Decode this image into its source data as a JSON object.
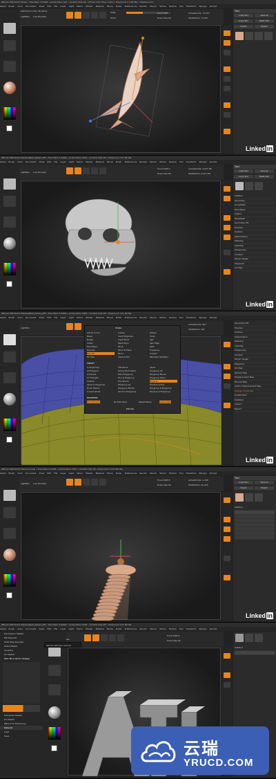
{
  "app": {
    "title_bar_1": "ZBrush 4R6 64-bit   Shark • Free Mem 3.24GB • Active Mem 700 • Scratch Disk 48 • ZTime 1.05 Timer 0.001 • PolyCount 1.4 Mil Mp • MeshCount 1",
    "title_bar_2": "ZBrush 4R6 64-bit   ZSphereBall_Sphere_Eff • Free Mem 4.15GB • Active Mem 1184 • Scratch Disk 48 • PolyCount 2.57 Mil Mp",
    "title_bar_3": "ZBrush 4R6 64-bit   ZSphereBall_Sphere_Eff • Free Mem 3.43GB • Active Mem 1366 • Scratch Disk 48 • PolyCount 1.21 Mil Mp",
    "title_bar_4": "ZBrush 4R6 64-bit   Helixed screw • Free Mem 5.12GB • Active Mem 1052 • Scratch Disk 48 • PolyCount 1.014 Mil Mp",
    "title_bar_5": "ZBrush 4R6 64-bit   ZSphereBall_Sphere_Eff • Free Mem 3.90GB • Active Mem 1336 • Scratch Disk 48 • PolyCount 2.21 Mil Mp"
  },
  "menubar": [
    "Alpha",
    "Brush",
    "Color",
    "Document",
    "Draw",
    "Edit",
    "File",
    "Layer",
    "Light",
    "Macro",
    "Marker",
    "Material",
    "Movie",
    "Picker",
    "Preferences",
    "Render",
    "Stencil",
    "Stroke",
    "Texture",
    "Tool",
    "Transform",
    "Zplugin",
    "Zscript"
  ],
  "toolbar": {
    "lightbox": "LightBox",
    "live_boolean": "Live Boolean",
    "edit": "Edit",
    "draw": "Draw",
    "move": "Move",
    "scale": "Scale",
    "rotate": "Rotate",
    "mrgb": "Mrgb",
    "rgb": "Rgb",
    "m": "M",
    "zadd": "Zadd",
    "zsub": "Zsub",
    "focal_shift": "Focal Shift 0",
    "draw_size": "Draw Size 64",
    "dynamic": "Dynamic",
    "active_points": "ActivePoints: 73,347",
    "total_points": "TotalPoints: 73,347",
    "active_points_2": "ActivePoints: 2.977 Mil",
    "total_points_2": "TotalPoints: 2.977 Mil",
    "active_points_3": "ActivePoints: 407",
    "total_points_3": "TotalPoints: 407",
    "active_points_4": "ActivePoints: 1.156",
    "total_points_4": "TotalPoints: 16,004"
  },
  "status_1": "Deformer Lines: 46 elbow",
  "left_shelf": {
    "alpha_off": "Alpha Off",
    "texture_off": "Texture Off",
    "gradient": "Gradient",
    "switch_color": "SwitchColor",
    "alternate": "Alternate"
  },
  "tray": {
    "header": "Tool",
    "buttons": [
      "Load Tool",
      "Save As",
      "Copy Tool",
      "Paste Tool",
      "Import",
      "Export",
      "Clone",
      "Make PolyMesh3D",
      "GoZ",
      "All",
      "Visible",
      "R"
    ],
    "lightbox_tools": "Lightbox▸Tools",
    "subtool_items": [
      "SubTool",
      "Geometry",
      "ArrayMesh",
      "NanoMesh",
      "Layers",
      "FiberMesh",
      "Geometry HD",
      "Preview",
      "Surface",
      "Deformation",
      "Masking",
      "Visibility",
      "Polygroups",
      "Contact",
      "Morph Target",
      "Polypaint",
      "UV Map",
      "Texture Map",
      "Displacement Map",
      "Normal Map",
      "Vector Displacement Map",
      "Display Properties",
      "Unified Skin",
      "Initialize",
      "Import",
      "Export"
    ]
  },
  "popup": {
    "title": "Stroke",
    "items_col1": [
      "Add To Curve",
      "Bevel",
      "Bridge",
      "Chisel",
      "Del Hidden",
      "Equalize",
      "Extrude",
      "Fill Hole"
    ],
    "items_col2": [
      "Crease",
      "Insert Edgeloop",
      "Insert Point",
      "Mask Polys",
      "Move",
      "Move To Plane",
      "Mirror",
      "Shadow Box"
    ],
    "items_col3": [
      "QMesh",
      "Scale",
      "Spin",
      "Spin Edge",
      "Split",
      "Transpose",
      "Unweld",
      "ZModeler Modifiers"
    ],
    "target_header": "TARGET",
    "targets_col1": [
      "A Single Poly",
      "All Polygons",
      "All Quads",
      "All Triangles",
      "Another",
      "Island & Polygroup",
      "Brush Radius",
      "Curved Island"
    ],
    "targets_col2": [
      "Flat Island",
      "Facing Point Island",
      "Plain Polygroup",
      "Plus & Polygroup",
      "Poly Border",
      "Polygroup All",
      "Polygroup Border",
      "Island & Polygroup"
    ],
    "targets_col3": [
      "Island",
      "Polygroup Alt",
      "Polygroup Border",
      "Polygroup Island",
      "Polyloop",
      "Polyloop & Poly",
      "Polygroup & Polygroup",
      "Polyloop & Polygroup"
    ],
    "modifiers_header": "MODIFIERS",
    "modifiers": [
      "Poly Fill Color",
      "No Fake Polys",
      "Repeat Bump",
      "Radius Mask"
    ],
    "extrude": "Extrude"
  },
  "left_menu_5": {
    "items": [
      "Decimation Master",
      "MD Exporter",
      "Multi Map Exporter",
      "Scale Master",
      "Sculptris",
      "UV Master",
      "Text 3D & Vector Shapes",
      "Transpose Master",
      "UV Master",
      "ZBrush To Photoshop",
      "Material",
      "Load",
      "Save"
    ],
    "tooltip": "Set the extrusion amount"
  },
  "linkedin": {
    "text": "Linked",
    "badge": "in"
  },
  "watermark": {
    "cn": "云瑞",
    "en": "YRUCD.COM"
  },
  "colors": {
    "accent": "#e8851f",
    "shark": "#d9a98c",
    "blue_mesh": "#4a4fa6",
    "yellow_mesh": "#8a8a2a",
    "watermark_bg": "#3b5fb4"
  },
  "icons": [
    "brush-icon",
    "sphere-icon",
    "cloud-logo-icon"
  ]
}
